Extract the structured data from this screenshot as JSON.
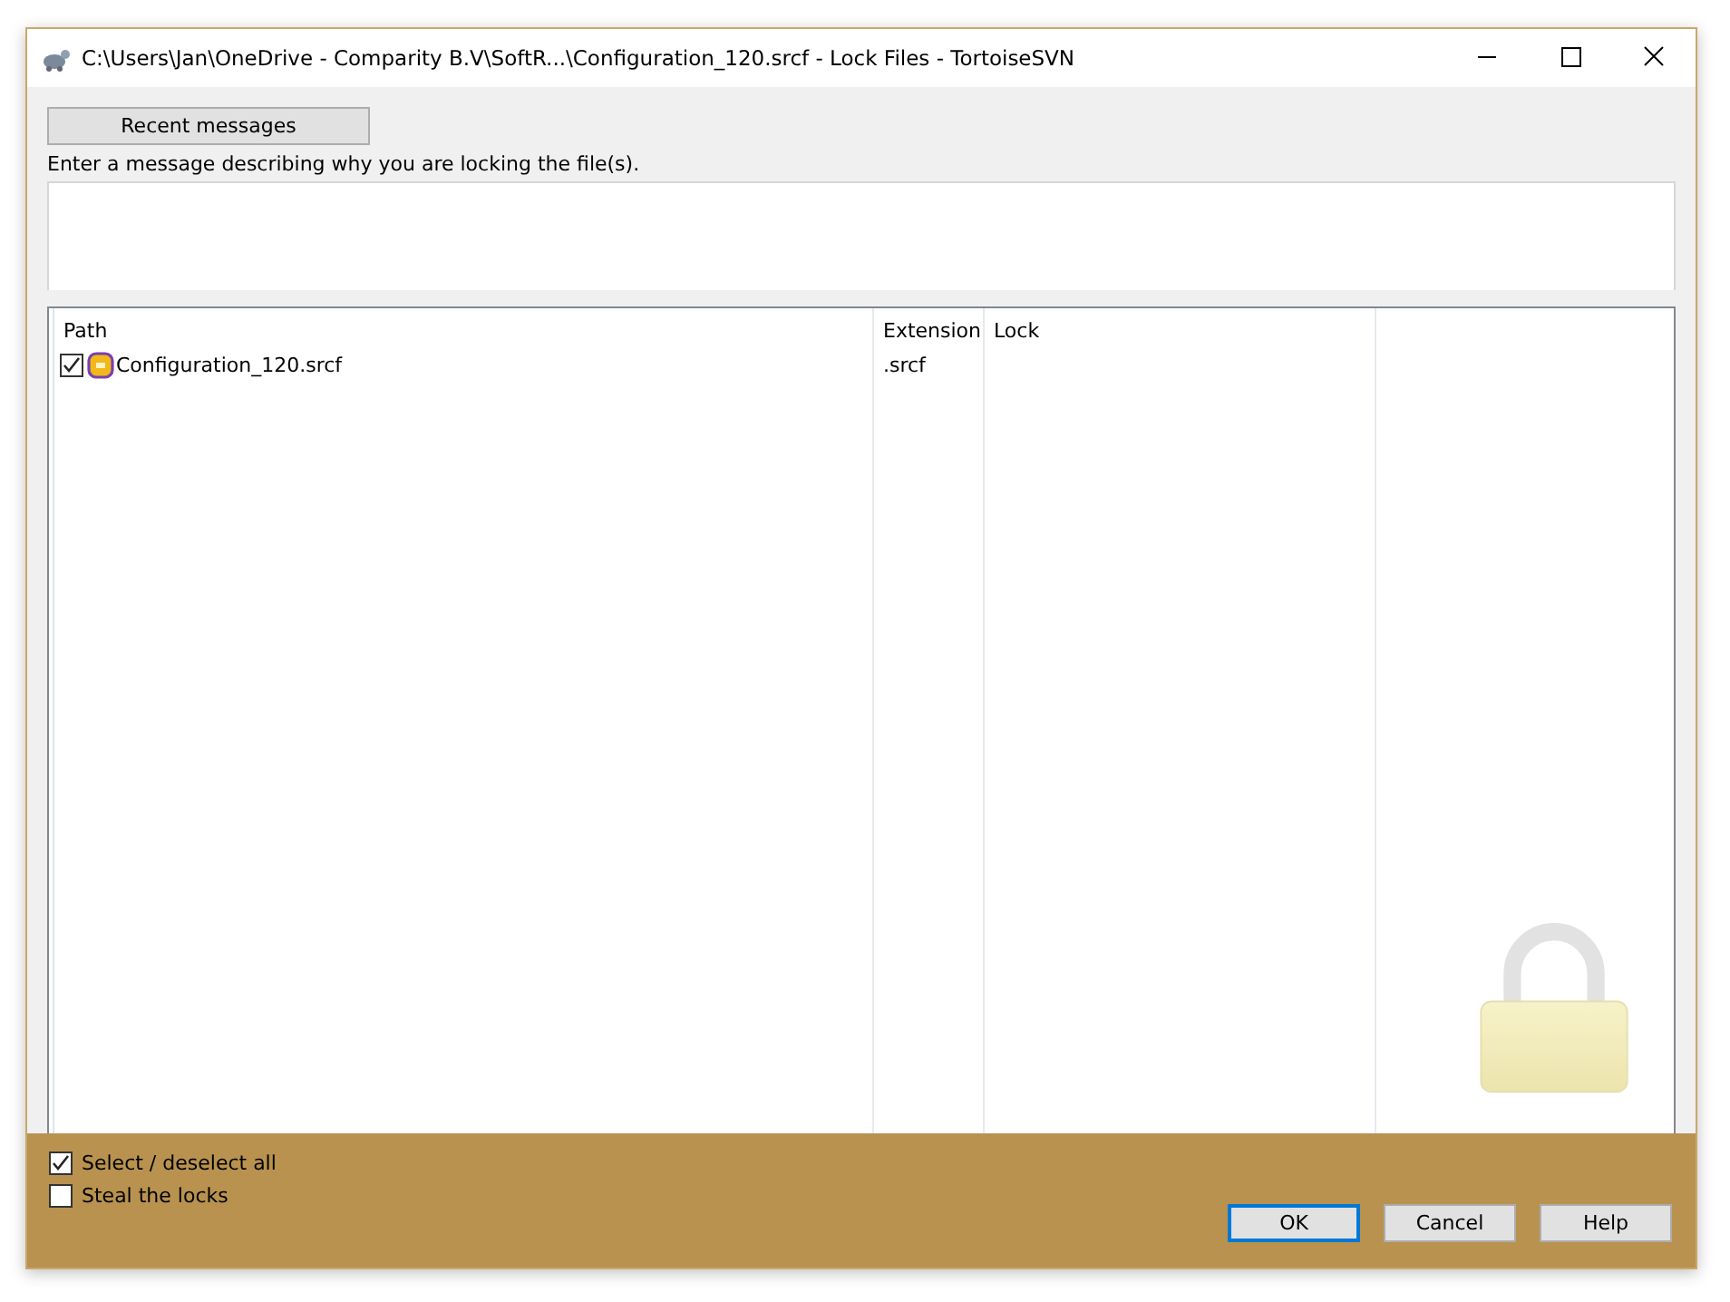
{
  "window": {
    "title": "C:\\Users\\Jan\\OneDrive - Comparity B.V\\SoftR...\\Configuration_120.srcf - Lock Files - TortoiseSVN"
  },
  "recent_messages_button": "Recent messages",
  "message_label": "Enter a message describing why you are locking the file(s).",
  "file_list": {
    "columns": [
      "Path",
      "Extension",
      "Lock"
    ],
    "rows": [
      {
        "checked": true,
        "path": "Configuration_120.srcf",
        "extension": ".srcf"
      }
    ]
  },
  "options": [
    {
      "label": "Select / deselect all",
      "checked": true
    },
    {
      "label": "Steal the locks",
      "checked": false
    }
  ],
  "buttons": [
    {
      "label": "OK",
      "kind": "default"
    },
    {
      "label": "Cancel",
      "kind": "normal"
    },
    {
      "label": "Help",
      "kind": "normal"
    }
  ]
}
